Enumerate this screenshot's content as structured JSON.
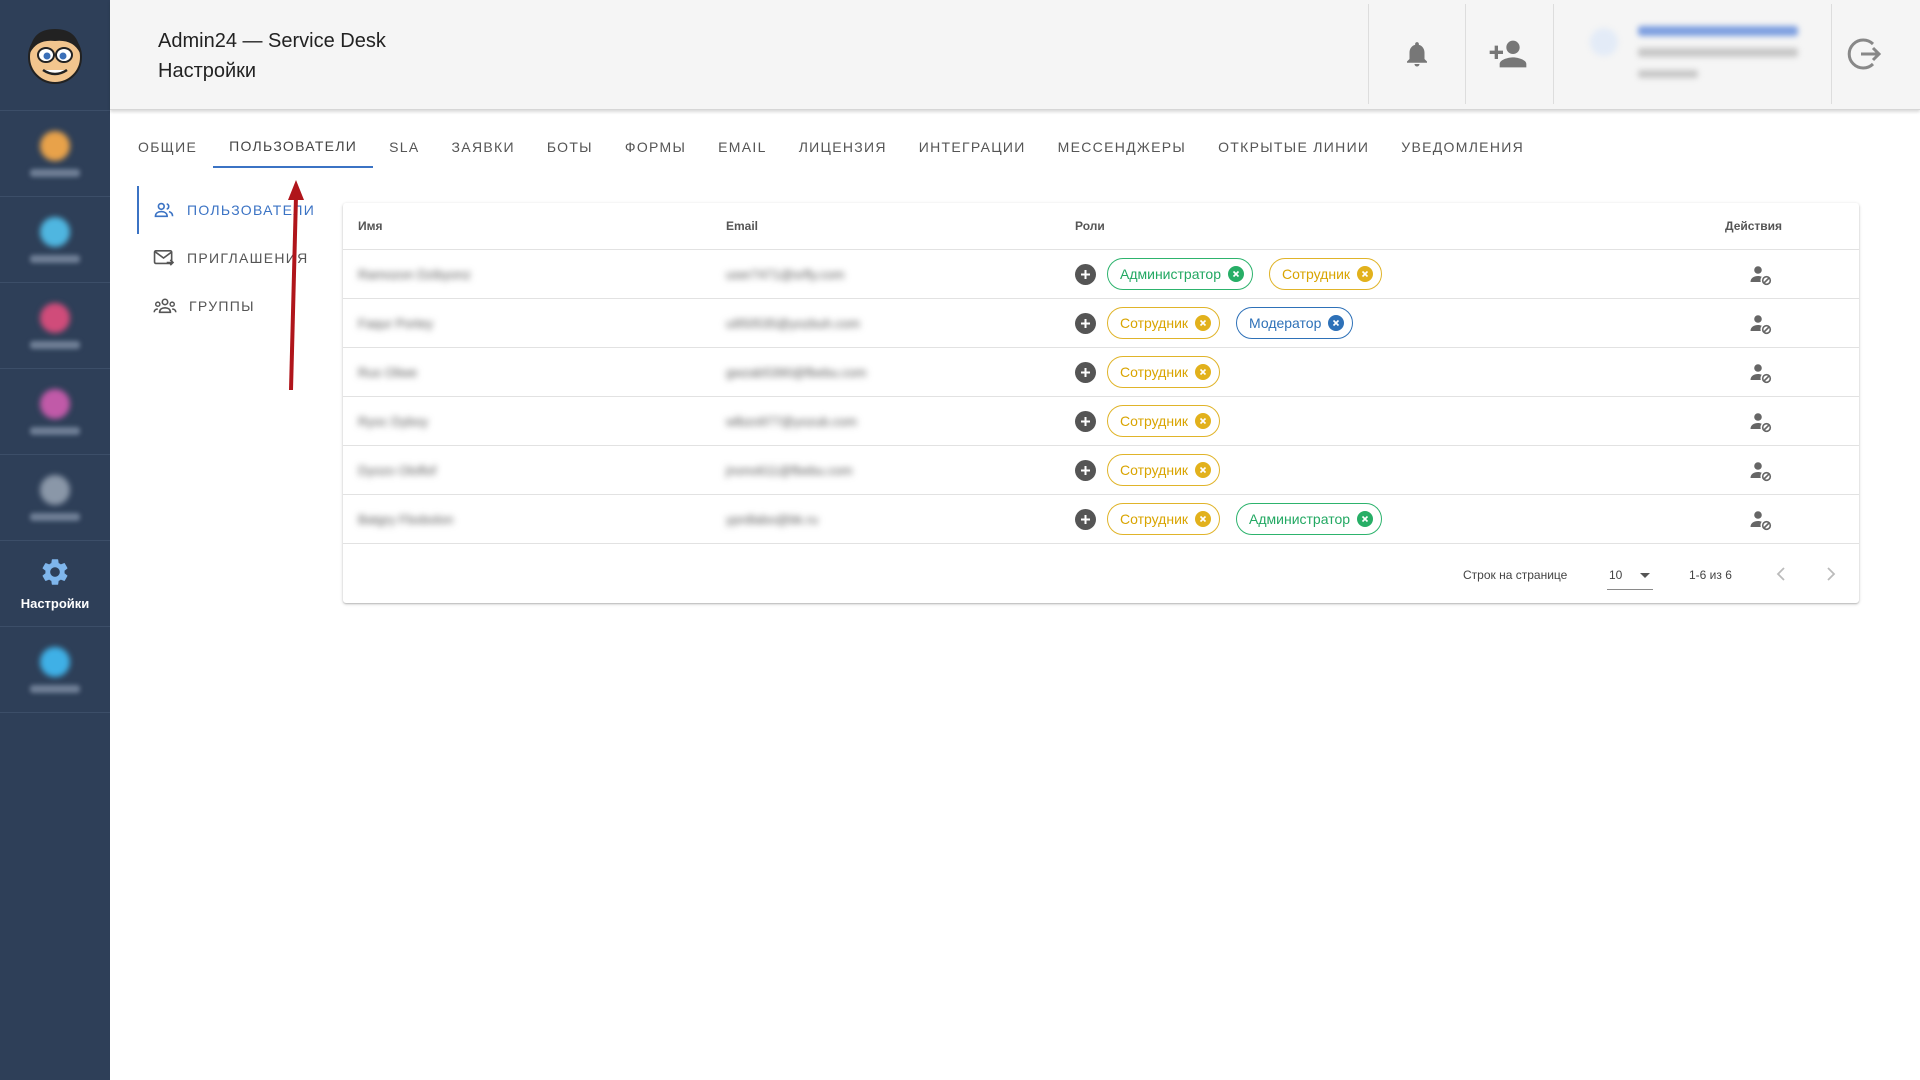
{
  "header": {
    "title_line1": "Admin24 — Service Desk",
    "title_line2": "Настройки"
  },
  "sidebar": {
    "items": [
      {
        "icon": "blurred-icon-1",
        "color": "#e8a24a"
      },
      {
        "icon": "blurred-icon-2",
        "color": "#4fb6e0"
      },
      {
        "icon": "blurred-icon-3",
        "color": "#d04c7a"
      },
      {
        "icon": "blurred-icon-4",
        "color": "#c15aa8"
      },
      {
        "icon": "blurred-icon-5",
        "color": "#8a97a8"
      },
      {
        "icon": "gear-icon",
        "label": "Настройки",
        "active": true
      },
      {
        "icon": "blurred-icon-7",
        "color": "#3fb0e6"
      }
    ]
  },
  "tabs": [
    "ОБЩИЕ",
    "ПОЛЬЗОВАТЕЛИ",
    "SLA",
    "ЗАЯВКИ",
    "БОТЫ",
    "ФОРМЫ",
    "EMAIL",
    "ЛИЦЕНЗИЯ",
    "ИНТЕГРАЦИИ",
    "МЕССЕНДЖЕРЫ",
    "ОТКРЫТЫЕ ЛИНИИ",
    "УВЕДОМЛЕНИЯ"
  ],
  "active_tab": "ПОЛЬЗОВАТЕЛИ",
  "subnav": [
    {
      "label": "ПОЛЬЗОВАТЕЛИ",
      "icon": "users-icon",
      "active": true
    },
    {
      "label": "ПРИГЛАШЕНИЯ",
      "icon": "invite-mail-icon"
    },
    {
      "label": "ГРУППЫ",
      "icon": "groups-icon"
    }
  ],
  "table": {
    "columns": {
      "name": "Имя",
      "email": "Email",
      "roles": "Роли",
      "actions": "Действия"
    },
    "rows": [
      {
        "name": "Ramozon Dzibyonz",
        "email": "user7471@srfly.com",
        "roles": [
          {
            "label": "Администратор",
            "color": "green"
          },
          {
            "label": "Сотрудник",
            "color": "yellow"
          }
        ]
      },
      {
        "name": "Faqur Portey",
        "email": "u950535@yozbuh.com",
        "roles": [
          {
            "label": "Сотрудник",
            "color": "yellow"
          },
          {
            "label": "Модератор",
            "color": "blue"
          }
        ]
      },
      {
        "name": "Rus Oliwe",
        "email": "gwzab5390@fbebu.com",
        "roles": [
          {
            "label": "Сотрудник",
            "color": "yellow"
          }
        ]
      },
      {
        "name": "Ryoc Dyboy",
        "email": "wlbzo977@yozub.com",
        "roles": [
          {
            "label": "Сотрудник",
            "color": "yellow"
          }
        ]
      },
      {
        "name": "Dyozo Oloflof",
        "email": "jnono611@fbebu.com",
        "roles": [
          {
            "label": "Сотрудник",
            "color": "yellow"
          }
        ]
      },
      {
        "name": "Batgry Fbobolon",
        "email": "yprdlabo@bk.ru",
        "roles": [
          {
            "label": "Сотрудник",
            "color": "yellow"
          },
          {
            "label": "Администратор",
            "color": "green"
          }
        ]
      }
    ]
  },
  "pagination": {
    "rows_per_page_label": "Строк на странице",
    "rows_per_page": "10",
    "range": "1-6 из 6"
  }
}
